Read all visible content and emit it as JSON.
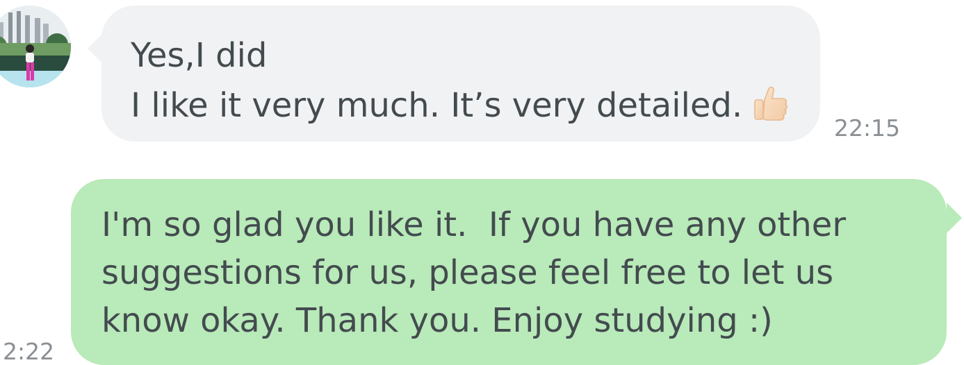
{
  "messages": [
    {
      "direction": "incoming",
      "lines": [
        "Yes,I did",
        "I like it very much. It’s very detailed."
      ],
      "emoji": "thumbs-up-icon",
      "time": "22:15",
      "colors": {
        "bubble": "#f1f2f4",
        "text": "#434b4f"
      }
    },
    {
      "direction": "outgoing",
      "lines": [
        "I'm so glad you like it.  If you have any other",
        "suggestions for us, please feel free to let us",
        "know okay. Thank you. Enjoy studying :)"
      ],
      "time": "2:22",
      "colors": {
        "bubble": "#b9eab9",
        "text": "#434b4f"
      }
    }
  ],
  "avatar": {
    "icon": "user-avatar-photo"
  }
}
